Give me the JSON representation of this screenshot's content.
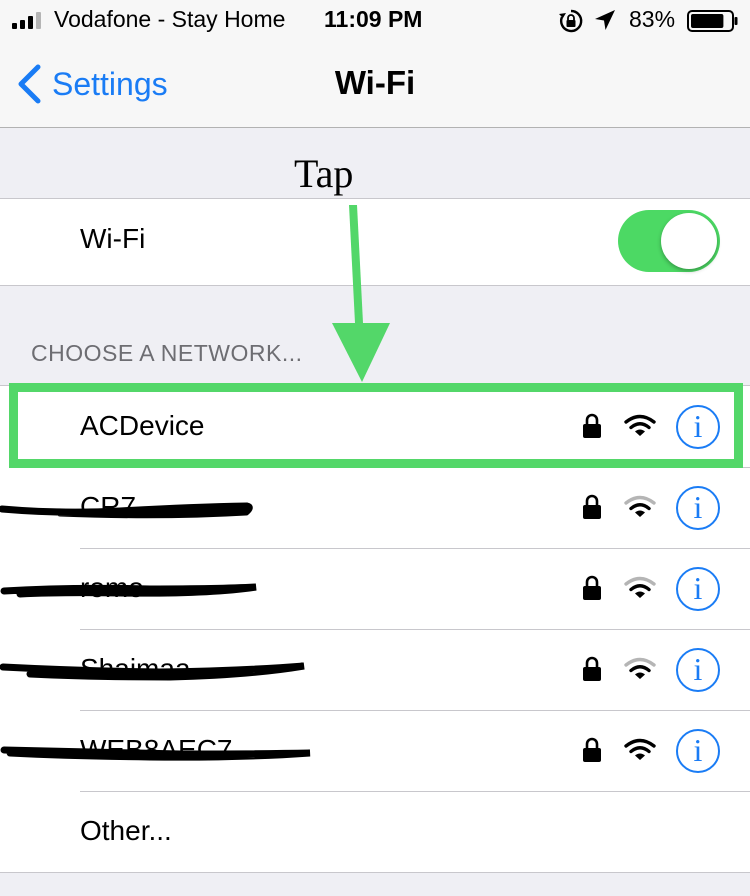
{
  "status_bar": {
    "carrier": "Vodafone - Stay Home",
    "time": "11:09 PM",
    "battery_percent": "83%",
    "battery_level": 0.83,
    "icons": [
      "signal-icon",
      "rotation-lock-icon",
      "location-arrow-icon",
      "battery-icon"
    ]
  },
  "nav": {
    "back_label": "Settings",
    "title": "Wi-Fi"
  },
  "annotation": {
    "tap_label": "Tap",
    "highlight_color": "#53d769"
  },
  "wifi": {
    "label": "Wi-Fi",
    "enabled": true,
    "toggle_color": "#4cd964"
  },
  "section_header": "CHOOSE A NETWORK...",
  "networks": [
    {
      "name": "ACDevice",
      "secured": true,
      "signal": "full"
    },
    {
      "name": "CR7",
      "secured": true,
      "signal": "partial",
      "scribbled": true
    },
    {
      "name": "romo",
      "secured": true,
      "signal": "partial",
      "scribbled": true
    },
    {
      "name": "Shaimaa",
      "secured": true,
      "signal": "partial",
      "scribbled": true
    },
    {
      "name": "WEB8AEC7",
      "secured": true,
      "signal": "full",
      "scribbled": true
    }
  ],
  "other_label": "Other...",
  "accent_color": "#1a7cf5"
}
